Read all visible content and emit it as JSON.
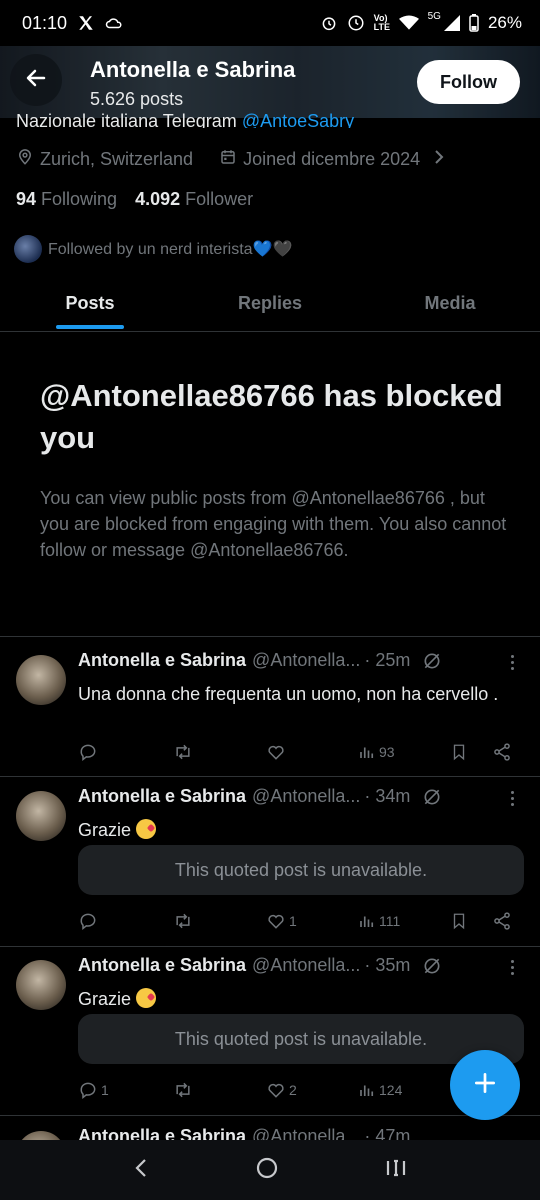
{
  "status": {
    "time": "01:10",
    "battery": "26%",
    "network": "5G",
    "volte": "Vo) LTE"
  },
  "header": {
    "name": "Antonella e Sabrina",
    "posts_count": "5.626 posts",
    "follow_label": "Follow"
  },
  "profile": {
    "bio_partial": "Nazionale italiana Telegram",
    "bio_link": "@AntoeSabry",
    "location": "Zurich, Switzerland",
    "joined": "Joined dicembre 2024",
    "following_count": "94",
    "following_label": "Following",
    "followers_count": "4.092",
    "followers_label": "Follower",
    "followed_by": "Followed by un nerd interista💙🖤"
  },
  "tabs": [
    {
      "label": "Posts"
    },
    {
      "label": "Replies"
    },
    {
      "label": "Media"
    }
  ],
  "blocked": {
    "title": "@Antonellae86766 has blocked you",
    "description": "You can view public posts from @Antonellae86766 , but you are blocked from engaging with them. You also cannot follow or message @Antonellae86766."
  },
  "posts": [
    {
      "name": "Antonella e Sabrina",
      "handle": "@Antonella...",
      "time": "· 25m",
      "text": "Una donna che frequenta un uomo, non ha cervello .",
      "quote": "",
      "replies": "",
      "reposts": "",
      "likes": "",
      "views": "93"
    },
    {
      "name": "Antonella e Sabrina",
      "handle": "@Antonella...",
      "time": "· 34m",
      "text": "Grazie",
      "quote": "This quoted post is unavailable.",
      "replies": "",
      "reposts": "",
      "likes": "1",
      "views": "111"
    },
    {
      "name": "Antonella e Sabrina",
      "handle": "@Antonella...",
      "time": "· 35m",
      "text": "Grazie",
      "quote": "This quoted post is unavailable.",
      "replies": "1",
      "reposts": "",
      "likes": "2",
      "views": "124"
    },
    {
      "name": "Antonella e Sabrina",
      "handle": "@Antonella...",
      "time": "· 47m"
    }
  ],
  "colors": {
    "accent": "#1d9bf0",
    "background": "#000000",
    "secondary_text": "#71767b"
  }
}
